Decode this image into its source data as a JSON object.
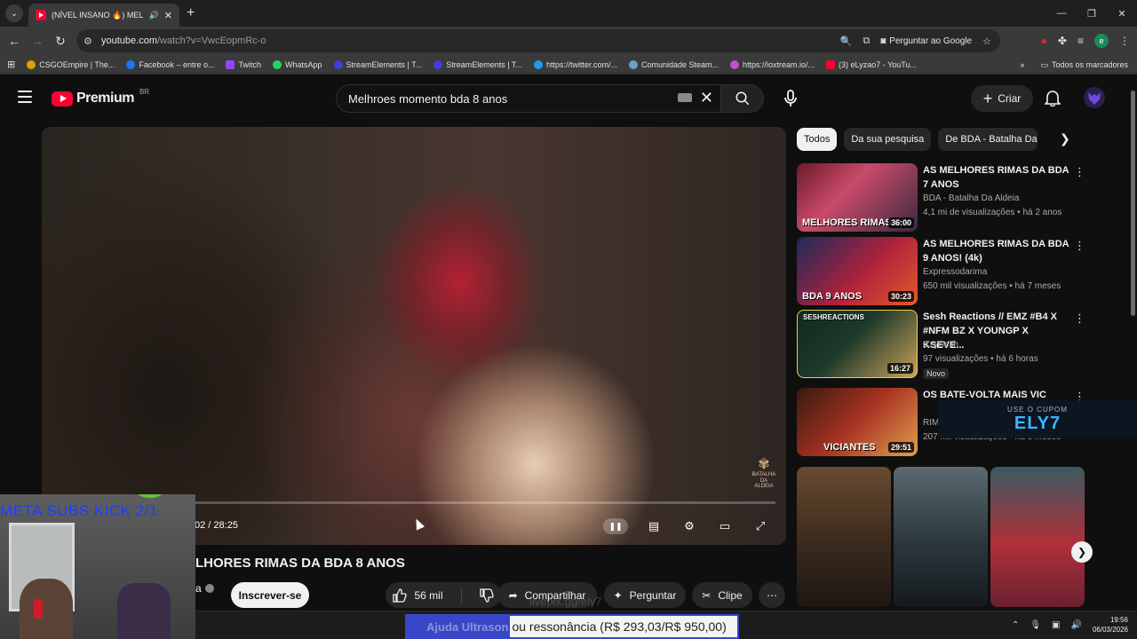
{
  "browser": {
    "tab_title": "(NÍVEL INSANO 🔥) MELHO",
    "url_host": "youtube.com",
    "url_path": "/watch?v=VwcEopmRc-o",
    "ask_google": "Perguntar ao Google",
    "bookmarks": [
      "CSGOEmpire | The...",
      "Facebook – entre o...",
      "Twitch",
      "WhatsApp",
      "StreamElements | T...",
      "StreamElements | T...",
      "https://twitter.com/...",
      "Comunidade Steam...",
      "https://ioxtream.io/...",
      "(3) eLyzao7 - YouTu..."
    ],
    "all_bookmarks": "Todos os marcadores",
    "profile_letter": "e"
  },
  "youtube": {
    "logo_word": "Premium",
    "country_code": "BR",
    "search_value": "Melhroes momento bda 8 anos",
    "create_label": "Criar"
  },
  "player": {
    "time": "02 / 28:25",
    "progress": 0.001,
    "watermark": "BATALHA DA ALDEIA"
  },
  "video": {
    "title": "LHORES RIMAS DA BDA 8 ANOS",
    "channel_fragment": "a",
    "subscribe": "Inscrever-se",
    "likes": "56 mil",
    "share": "Compartilhar",
    "ask": "Perguntar",
    "clip": "Clipe"
  },
  "chips": [
    "Todos",
    "Da sua pesquisa",
    "De BDA - Batalha Da Aldeia"
  ],
  "recommendations": [
    {
      "title": "AS MELHORES RIMAS DA BDA 7 ANOS",
      "channel": "BDA - Batalha Da Aldeia",
      "meta": "4,1 mi de visualizações • há 2 anos",
      "duration": "36:00",
      "thumb_text": "MELHORES RIMAS DA"
    },
    {
      "title": "AS MELHORES RIMAS DA BDA 9 ANOS! (4k)",
      "channel": "Expressodarima",
      "meta": "650 mil visualizações • há 7 meses",
      "duration": "30:23",
      "thumb_text": "BDA 9 ANOS"
    },
    {
      "title": "Sesh Reactions // EMZ #B4 X #NFM BZ X YOUNGP X KSEVE...",
      "channel": "CzySesh",
      "meta": "97 visualizações • há 6 horas",
      "duration": "16:27",
      "badge": "Novo",
      "thumb_text": "SESHREACTIONS"
    },
    {
      "title": "OS BATE-VOLTA MAIS VIC",
      "channel": "RIM",
      "meta": "207 mil visualizações • há 6 meses",
      "duration": "29:51",
      "thumb_text": "VICIANTES"
    }
  ],
  "overlays": {
    "coupon_small": "USE O CUPOM",
    "coupon_code": "ELY7",
    "cam_text": "META SUBS KICK 2/1",
    "donate_highlight": "Ajuda Ultrason",
    "donate_rest": "ou ressonância (R$ 293,03/R$ 950,00)",
    "ghost_link": "livepix.gg/ely7"
  },
  "taskbar": {
    "time": "19:56",
    "date": "06/03/2026"
  }
}
